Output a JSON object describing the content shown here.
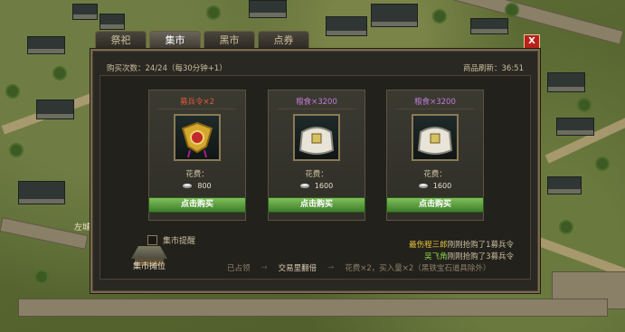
{
  "tabs": [
    "祭祀",
    "集市",
    "黑市",
    "点券"
  ],
  "active_tab": 1,
  "close_label": "X",
  "panel": {
    "purchase_count": "购买次数：24/24（每30分钟+1）",
    "refresh_timer": "商品刷新：36:51"
  },
  "cards": [
    {
      "title": "募兵令×2",
      "title_color": "red",
      "icon": "golden-ornament-icon",
      "cost_label": "花费：",
      "price": "800",
      "buy_label": "点击购买"
    },
    {
      "title": "粮食×3200",
      "title_color": "purple",
      "icon": "grain-sack-icon",
      "cost_label": "花费：",
      "price": "1600",
      "buy_label": "点击购买"
    },
    {
      "title": "粮食×3200",
      "title_color": "purple",
      "icon": "grain-sack-icon",
      "cost_label": "花费：",
      "price": "1600",
      "buy_label": "点击购买"
    }
  ],
  "market_reminder": "集市提醒",
  "log": [
    {
      "name": "最伤程三郎",
      "text": "刚刚抢购了1募兵令"
    },
    {
      "name": "吴飞角",
      "text": "刚刚抢购了3募兵令"
    }
  ],
  "stall_label": "集市摊位",
  "steps": [
    "已占领",
    "交易里翻倍",
    "花费×2，买入量×2（黑铁宝石道具除外）"
  ],
  "map_label": "左城"
}
